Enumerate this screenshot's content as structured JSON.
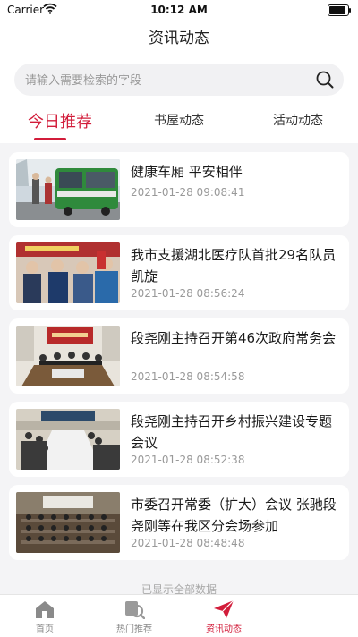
{
  "status_bar": {
    "carrier": "Carrier",
    "time": "10:12 AM",
    "battery_level": 0.85
  },
  "header": {
    "title": "资讯动态"
  },
  "search": {
    "placeholder": "请输入需要检索的字段",
    "value": ""
  },
  "tabs": [
    {
      "label": "今日推荐",
      "active": true
    },
    {
      "label": "书屋动态",
      "active": false
    },
    {
      "label": "活动动态",
      "active": false
    }
  ],
  "news": [
    {
      "title": "健康车厢 平安相伴",
      "date": "2021-01-28 09:08:41",
      "thumb": "bus-photo"
    },
    {
      "title": "我市支援湖北医疗队首批29名队员凯旋",
      "date": "2021-01-28 08:56:24",
      "thumb": "crowd-photo"
    },
    {
      "title": "段尧刚主持召开第46次政府常务会",
      "date": "2021-01-28 08:54:58",
      "thumb": "meeting-photo"
    },
    {
      "title": "段尧刚主持召开乡村振兴建设专题会议",
      "date": "2021-01-28 08:52:38",
      "thumb": "conference-photo"
    },
    {
      "title": "市委召开常委（扩大）会议 张驰段尧刚等在我区分会场参加",
      "date": "2021-01-28 08:48:48",
      "thumb": "hall-photo"
    }
  ],
  "list_footer": "已显示全部数据",
  "tabbar": [
    {
      "label": "首页",
      "icon": "home-icon",
      "active": false
    },
    {
      "label": "热门推荐",
      "icon": "hot-icon",
      "active": false
    },
    {
      "label": "资讯动态",
      "icon": "paper-plane-icon",
      "active": true
    }
  ],
  "colors": {
    "accent": "#d21c3a",
    "background": "#f4f4f6"
  }
}
